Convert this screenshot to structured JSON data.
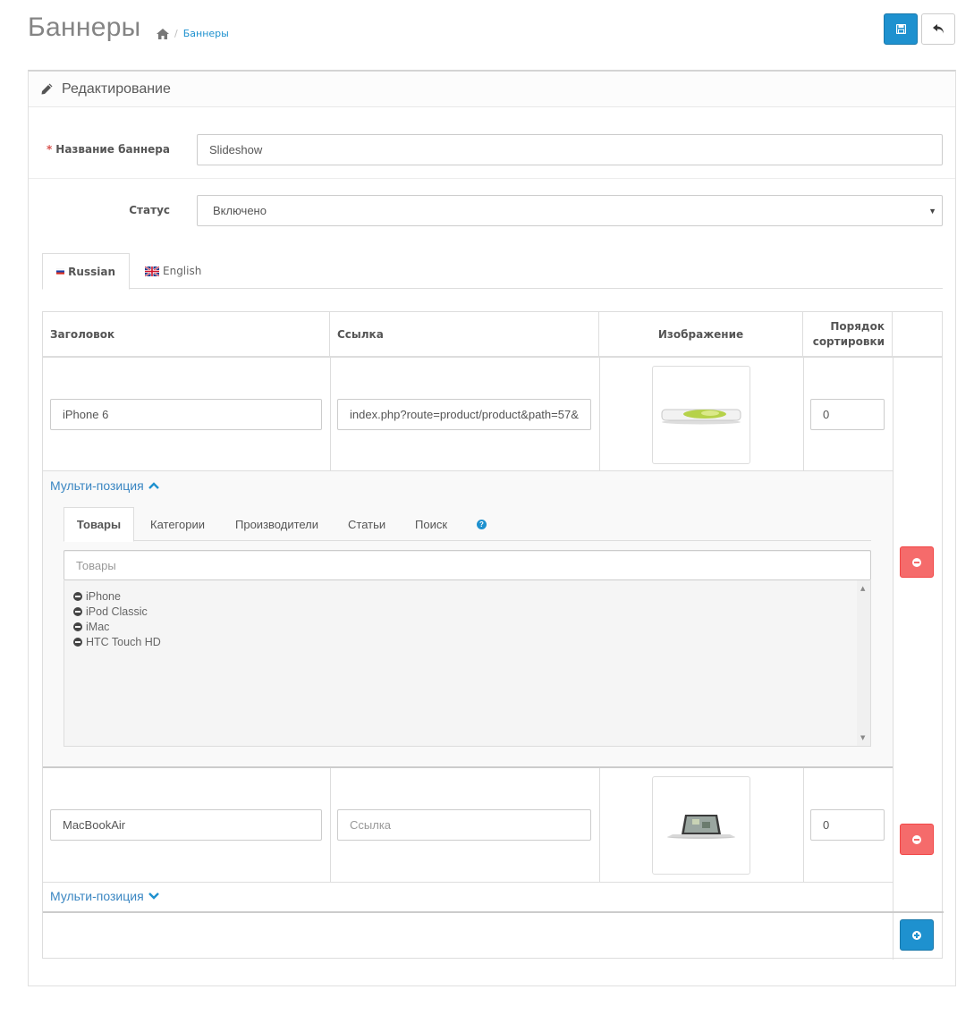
{
  "header": {
    "title": "Баннеры",
    "breadcrumb": {
      "current": "Баннеры"
    },
    "icons": {
      "home": "home-icon",
      "save": "save-icon",
      "back": "reply-icon"
    }
  },
  "panel": {
    "heading": "Редактирование",
    "icon": "pencil-icon"
  },
  "form": {
    "name_label": "Название баннера",
    "name_value": "Slideshow",
    "status_label": "Статус",
    "status_value": "Включено"
  },
  "language_tabs": [
    {
      "label": "Russian",
      "active": true
    },
    {
      "label": "English",
      "active": false
    }
  ],
  "table": {
    "headers": {
      "title": "Заголовок",
      "link": "Ссылка",
      "image": "Изображение",
      "sort_line1": "Порядок",
      "sort_line2": "сортировки"
    },
    "rows": [
      {
        "title": "iPhone 6",
        "link": "index.php?route=product/product&path=57&",
        "link_placeholder": "Ссылка",
        "sort_order": "0",
        "multi_label": "Мульти-позиция",
        "expanded": true
      },
      {
        "title": "MacBookAir",
        "link": "",
        "link_placeholder": "Ссылка",
        "sort_order": "0",
        "multi_label": "Мульти-позиция",
        "expanded": false
      }
    ]
  },
  "multi_position": {
    "tabs": [
      "Товары",
      "Категории",
      "Производители",
      "Статьи",
      "Поиск"
    ],
    "search_placeholder": "Товары",
    "items": [
      "iPhone",
      "iPod Classic",
      "iMac",
      "HTC Touch HD"
    ]
  },
  "colors": {
    "primary": "#1e91cf",
    "danger": "#f56b6b",
    "link": "#3a86c2"
  }
}
